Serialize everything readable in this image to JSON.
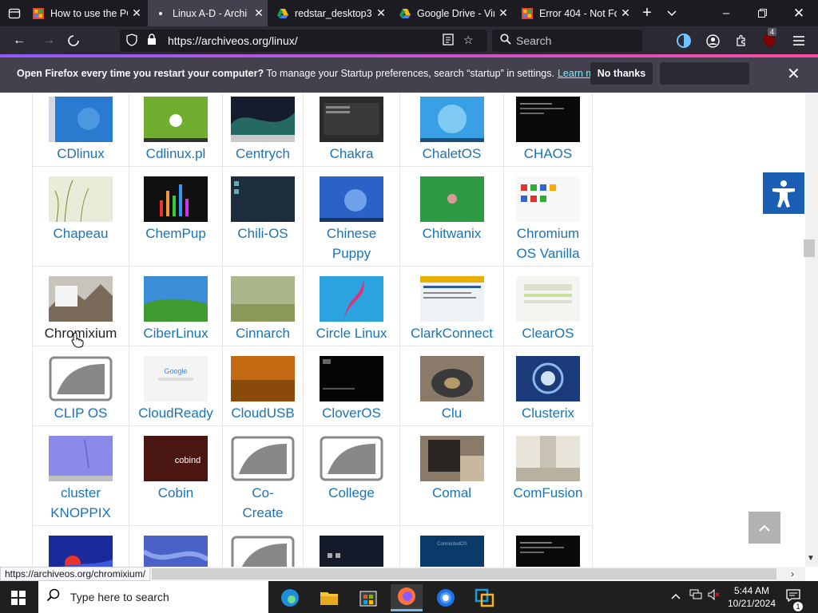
{
  "tabs": [
    {
      "title": "How to use the PC",
      "favicon": "youtube-icon",
      "active": false
    },
    {
      "title": "Linux A-D - Archi",
      "favicon": "dot-icon",
      "active": true
    },
    {
      "title": "redstar_desktop3.",
      "favicon": "google-drive-icon",
      "active": false
    },
    {
      "title": "Google Drive - Vir",
      "favicon": "google-drive-icon",
      "active": false
    },
    {
      "title": "Error 404 - Not Fo",
      "favicon": "page-icon",
      "active": false
    }
  ],
  "nav": {
    "url": "https://archiveos.org/linux/",
    "search_placeholder": "Search",
    "extension_badge": "4"
  },
  "notification": {
    "bold": "Open Firefox every time you restart your computer?",
    "text": " To manage your Startup preferences, search “startup” in settings.",
    "link": "Learn more",
    "no_thanks": "No thanks"
  },
  "grid": [
    [
      {
        "name": "CDlinux",
        "thumb": "blue-desktop"
      },
      {
        "name": "Cdlinux.pl",
        "thumb": "green-desktop"
      },
      {
        "name": "Centrych",
        "thumb": "aurora"
      },
      {
        "name": "Chakra",
        "thumb": "dark-menu"
      },
      {
        "name": "ChaletOS",
        "thumb": "win-blue"
      },
      {
        "name": "CHAOS",
        "thumb": "terminal"
      }
    ],
    [
      {
        "name": "Chapeau",
        "thumb": "grass"
      },
      {
        "name": "ChemPup",
        "thumb": "bars"
      },
      {
        "name": "Chili-OS",
        "thumb": "dark-blue"
      },
      {
        "name": "Chinese\nPuppy",
        "thumb": "win7"
      },
      {
        "name": "Chitwanix",
        "thumb": "green-logo"
      },
      {
        "name": "Chromium\nOS Vanilla",
        "thumb": "chrome-apps"
      }
    ],
    [
      {
        "name": "Chromixium",
        "thumb": "mountain",
        "hovered": true
      },
      {
        "name": "CiberLinux",
        "thumb": "xp-field"
      },
      {
        "name": "Cinnarch",
        "thumb": "meadow"
      },
      {
        "name": "Circle Linux",
        "thumb": "pink-swirl"
      },
      {
        "name": "ClarkConnect",
        "thumb": "web-admin"
      },
      {
        "name": "ClearOS",
        "thumb": "light-admin"
      }
    ],
    [
      {
        "name": "CLIP OS",
        "thumb": "placeholder"
      },
      {
        "name": "CloudReady",
        "thumb": "google-page"
      },
      {
        "name": "CloudUSB",
        "thumb": "orange"
      },
      {
        "name": "CloverOS",
        "thumb": "black-term"
      },
      {
        "name": "Clu",
        "thumb": "disk"
      },
      {
        "name": "Clusterix",
        "thumb": "spiral"
      }
    ],
    [
      {
        "name": "cluster\nKNOPPIX",
        "thumb": "periwinkle"
      },
      {
        "name": "Cobin",
        "thumb": "cobind"
      },
      {
        "name": "Co-\nCreate",
        "thumb": "placeholder"
      },
      {
        "name": "College",
        "thumb": "placeholder"
      },
      {
        "name": "Comal",
        "thumb": "photo-gray"
      },
      {
        "name": "ComFusion",
        "thumb": "room"
      }
    ],
    [
      {
        "name": "",
        "thumb": "blue-glow"
      },
      {
        "name": "",
        "thumb": "blue-soft"
      },
      {
        "name": "",
        "thumb": "placeholder"
      },
      {
        "name": "",
        "thumb": "dark-icons"
      },
      {
        "name": "",
        "thumb": "connect-blue"
      },
      {
        "name": "",
        "thumb": "terminal"
      }
    ]
  ],
  "status_url": "https://archiveos.org/chromixium/",
  "taskbar": {
    "search_placeholder": "Type here to search",
    "time": "5:44 AM",
    "date": "10/21/2024"
  }
}
